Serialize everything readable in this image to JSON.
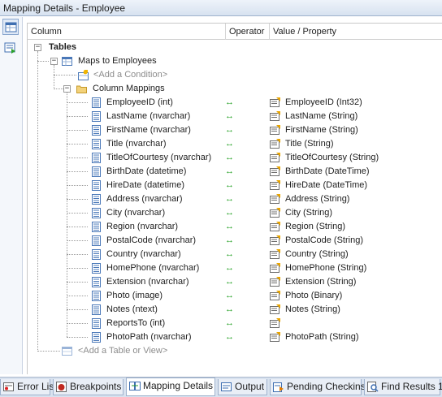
{
  "window": {
    "title": "Mapping Details - Employee"
  },
  "columns": {
    "column": "Column",
    "operator": "Operator",
    "value": "Value / Property"
  },
  "tree": {
    "tables_label": "Tables",
    "maps_to": "Maps to Employees",
    "add_condition": "<Add a Condition>",
    "column_mappings": "Column Mappings",
    "add_table": "<Add a Table or View>",
    "arrow_glyph": "↔",
    "mappings": [
      {
        "column": "EmployeeID (int)",
        "property": "EmployeeID (Int32)"
      },
      {
        "column": "LastName (nvarchar)",
        "property": "LastName (String)"
      },
      {
        "column": "FirstName (nvarchar)",
        "property": "FirstName (String)"
      },
      {
        "column": "Title (nvarchar)",
        "property": "Title (String)"
      },
      {
        "column": "TitleOfCourtesy (nvarchar)",
        "property": "TitleOfCourtesy (String)"
      },
      {
        "column": "BirthDate (datetime)",
        "property": "BirthDate (DateTime)"
      },
      {
        "column": "HireDate (datetime)",
        "property": "HireDate (DateTime)"
      },
      {
        "column": "Address (nvarchar)",
        "property": "Address (String)"
      },
      {
        "column": "City (nvarchar)",
        "property": "City (String)"
      },
      {
        "column": "Region (nvarchar)",
        "property": "Region (String)"
      },
      {
        "column": "PostalCode (nvarchar)",
        "property": "PostalCode (String)"
      },
      {
        "column": "Country (nvarchar)",
        "property": "Country (String)"
      },
      {
        "column": "HomePhone (nvarchar)",
        "property": "HomePhone (String)"
      },
      {
        "column": "Extension (nvarchar)",
        "property": "Extension (String)"
      },
      {
        "column": "Photo (image)",
        "property": "Photo (Binary)"
      },
      {
        "column": "Notes (ntext)",
        "property": "Notes (String)"
      },
      {
        "column": "ReportsTo (int)",
        "property": ""
      },
      {
        "column": "PhotoPath (nvarchar)",
        "property": "PhotoPath (String)"
      }
    ]
  },
  "tabs": [
    {
      "label": "Error List",
      "icon": "error-list-icon"
    },
    {
      "label": "Breakpoints",
      "icon": "breakpoints-icon"
    },
    {
      "label": "Mapping Details",
      "icon": "mapping-details-icon",
      "active": true
    },
    {
      "label": "Output",
      "icon": "output-icon"
    },
    {
      "label": "Pending Checkins",
      "icon": "pending-checkins-icon"
    },
    {
      "label": "Find Results 1",
      "icon": "find-results-icon"
    }
  ],
  "colors": {
    "arrow": "#1a9c1a",
    "titlebar": "#d7e2f0",
    "tabstrip": "#d8e2ef"
  }
}
